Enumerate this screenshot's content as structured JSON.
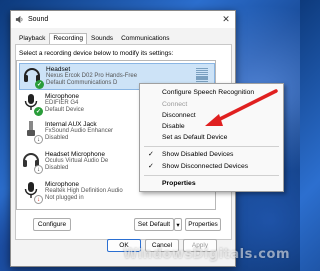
{
  "window": {
    "title": "Sound",
    "close_glyph": "✕"
  },
  "tabs": [
    {
      "label": "Playback",
      "active": false
    },
    {
      "label": "Recording",
      "active": true
    },
    {
      "label": "Sounds",
      "active": false
    },
    {
      "label": "Communications",
      "active": false
    }
  ],
  "instruction": "Select a recording device below to modify its settings:",
  "devices": [
    {
      "name": "Headset",
      "subtitle": "Nexus Ercok D02 Pro Hands-Free",
      "status": "Default Communications D",
      "icon": "headset-icon",
      "badge": "green-check",
      "selected": true
    },
    {
      "name": "Microphone",
      "subtitle": "EDIFIER G4",
      "status": "Default Device",
      "icon": "microphone-icon",
      "badge": "green-check",
      "selected": false
    },
    {
      "name": "Internal AUX Jack",
      "subtitle": "FxSound Audio Enhancer",
      "status": "Disabled",
      "icon": "aux-jack-icon",
      "badge": "down-arrow",
      "selected": false
    },
    {
      "name": "Headset Microphone",
      "subtitle": "Oculus Virtual Audio De",
      "status": "Disabled",
      "icon": "headset-icon",
      "badge": "down-arrow",
      "selected": false
    },
    {
      "name": "Microphone",
      "subtitle": "Realtek High Definition Audio",
      "status": "Not plugged in",
      "icon": "microphone-icon",
      "badge": "red-down-arrow",
      "selected": false
    }
  ],
  "buttons": {
    "configure": "Configure",
    "set_default": "Set Default",
    "set_default_arrow": "▾",
    "properties": "Properties",
    "ok": "OK",
    "cancel": "Cancel",
    "apply": "Apply"
  },
  "context_menu": {
    "items": [
      {
        "label": "Configure Speech Recognition",
        "enabled": true,
        "checked": false,
        "bold": false
      },
      {
        "label": "Connect",
        "enabled": false,
        "checked": false,
        "bold": false
      },
      {
        "label": "Disconnect",
        "enabled": true,
        "checked": false,
        "bold": false
      },
      {
        "label": "Disable",
        "enabled": true,
        "checked": false,
        "bold": false
      },
      {
        "label": "Set as Default Device",
        "enabled": true,
        "checked": false,
        "bold": false
      },
      {
        "label": "Show Disabled Devices",
        "enabled": true,
        "checked": true,
        "bold": false
      },
      {
        "label": "Show Disconnected Devices",
        "enabled": true,
        "checked": true,
        "bold": false
      },
      {
        "label": "Properties",
        "enabled": true,
        "checked": false,
        "bold": true
      }
    ],
    "check_glyph": "✓"
  },
  "watermark": "WindowsDigitals.com",
  "colors": {
    "accent": "#2b6fd1",
    "selection": "#cde3f7",
    "annotation_arrow": "#e02020",
    "status_green": "#2a9d3a"
  }
}
